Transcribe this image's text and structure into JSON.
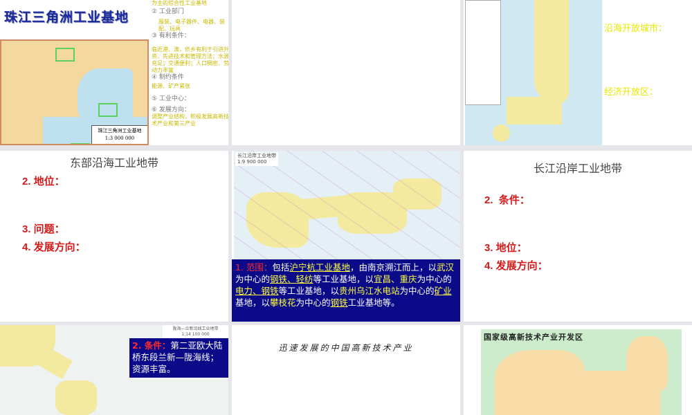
{
  "slides": [
    {
      "title": "珠江三角洲工业基地",
      "map_caption": "珠江三角洲工业基地",
      "map_scale": "1:3 000 000",
      "notes": [
        "为主的综合性工业基地",
        "② 工业部门",
        "服装、电子器件、电器、装配、玩具",
        "③ 有利条件：",
        "临近港、澳，侨乡有利于引进外资、先进技术和管理方法；水源充足；交通便利；人口稠密、劳动力丰富",
        "④ 制约条件",
        "能源、矿产紧张",
        "⑤ 工业中心：",
        "⑥ 发展方向：",
        "调整产业结构，积极发展高新技术产业和第三产业"
      ]
    },
    {},
    {
      "labels": [
        "沿海开放城市：",
        "经济开放区："
      ]
    },
    {
      "title": "东部沿海工业地带",
      "items": [
        "2. 地位：",
        "3. 问题：",
        "4. 发展方向："
      ]
    },
    {
      "map_title": "长江沿岸工业地带",
      "map_scale": "1:9 900 000",
      "text": {
        "label": "1. 范围：",
        "p1": "包括",
        "u1": "沪宁杭工业基地",
        "p2": "，由南京溯江而上，以",
        "y1": "武汉",
        "p3": "为中心的",
        "u2": "钢铁、轻纺",
        "p4": "等工业基地，以",
        "y2": "宜昌、重庆",
        "p5": "为中心的",
        "u3": "电力、钢铁",
        "p6": "等工业基地，以",
        "y3": "贵州乌江水电站",
        "p7": "为中心的",
        "u4": "矿业",
        "p8": "基地，以",
        "y4": "攀枝花",
        "p9": "为中心的",
        "u5": "钢铁",
        "p10": "工业基地等。"
      }
    },
    {
      "title": "长江沿岸工业地带",
      "items": [
        "2.  条件：",
        "3. 地位：",
        "4. 发展方向："
      ]
    },
    {
      "map_title": "陇海—兰新沿线工业地带",
      "map_scale": "1:14 100 000",
      "text": {
        "label": "2. 条件：",
        "body": "第二亚欧大陆桥东段兰新—陇海线；资源丰富。"
      }
    },
    {
      "title": "迅速发展的中国高新技术产业"
    },
    {
      "map_title": "国家级高新技术产业开发区"
    }
  ],
  "colors": {
    "title_blue": "#1a2a9a",
    "red": "#d41a1a",
    "box_blue": "#0b0b8a",
    "yellow": "#ffff40"
  }
}
